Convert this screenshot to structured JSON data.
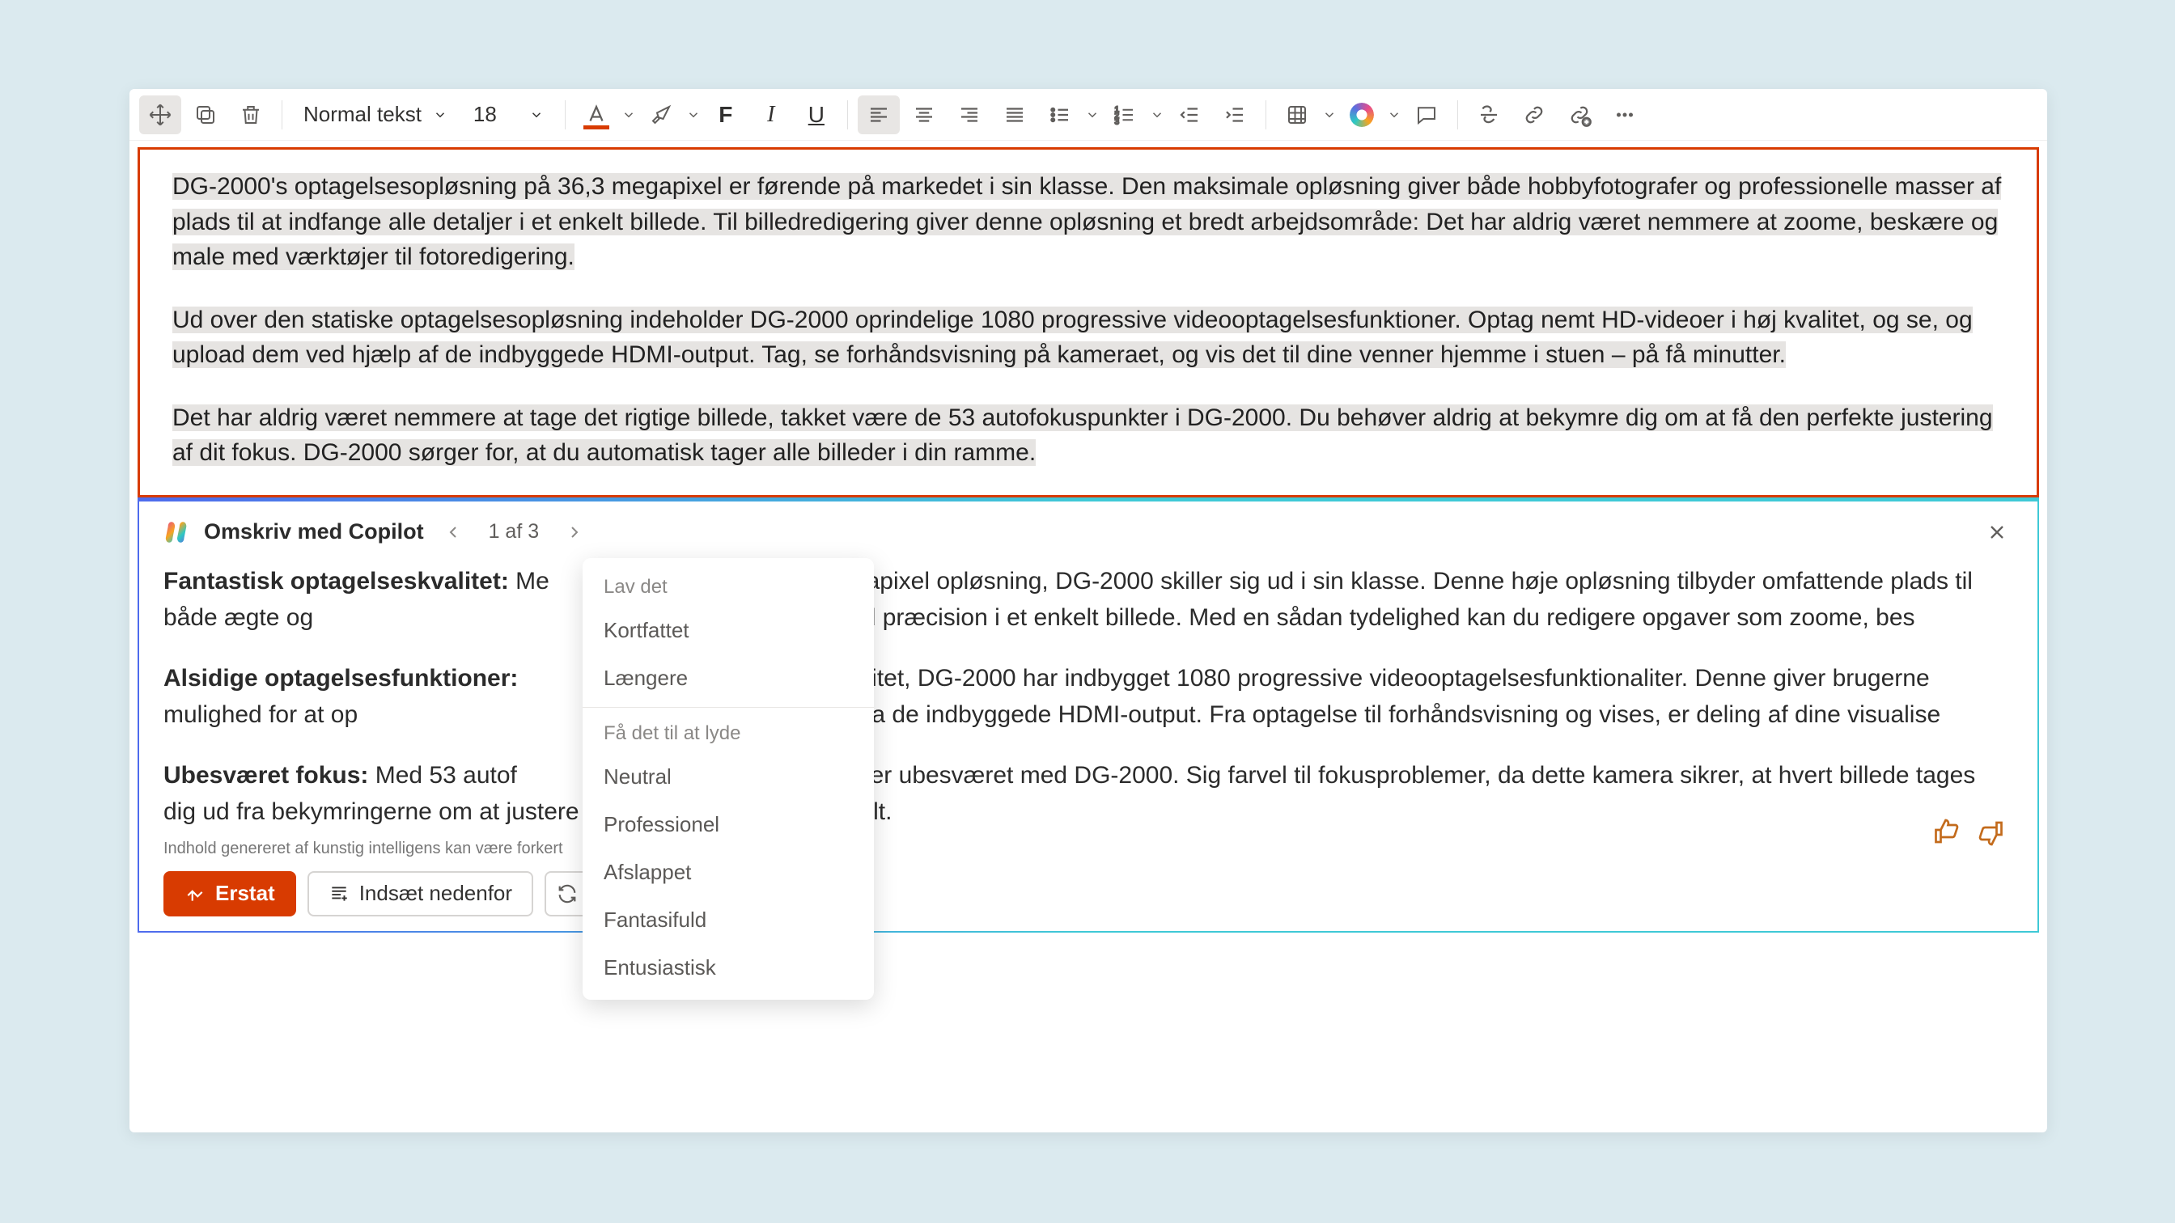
{
  "toolbar": {
    "style": "Normal tekst",
    "fontSize": "18"
  },
  "doc": {
    "p1": "DG-2000's optagelsesopløsning på 36,3 megapixel er førende på markedet i sin klasse. Den maksimale opløsning giver både hobbyfotografer og professionelle masser af plads til at indfange alle detaljer i et enkelt billede. Til billedredigering giver denne opløsning et bredt arbejdsområde: Det har aldrig været nemmere at zoome, beskære og male med værktøjer til fotoredigering.",
    "p2": "Ud over den statiske optagelsesopløsning indeholder DG-2000 oprindelige 1080 progressive videooptagelsesfunktioner. Optag nemt HD-videoer i høj kvalitet, og se, og upload dem ved hjælp af de indbyggede HDMI-output. Tag, se forhåndsvisning på kameraet, og vis det til dine venner hjemme i stuen – på få minutter.",
    "p3": "Det har aldrig været nemmere at tage det rigtige billede, takket være de 53 autofokuspunkter i DG-2000. Du behøver aldrig at bekymre dig om at få den perfekte justering af dit fokus. DG-2000 sørger for, at du automatisk tager alle billeder i din ramme."
  },
  "copilot": {
    "title": "Omskriv med Copilot",
    "counter": "1 af 3",
    "p1b": "Fantastisk optagelseskvalitet:",
    "p1": " Me                                             gapixel opløsning, DG-2000 skiller sig ud i sin klasse. Denne høje opløsning tilbyder omfattende plads til både ægte og                                            tag intrikate detaljer med præcision i et enkelt billede. Med en sådan tydelighed kan du redigere opgaver som zoome, bes",
    "p2b": "Alsidige optagelsesfunktioner:",
    "p2": "                                              kvalitet, DG-2000 har indbygget 1080 progressive videooptagelsesfunktionaliter. Denne giver brugerne mulighed for at op                                     kan du nemt dele dem via de indbyggede HDMI-output. Fra optagelse til forhåndsvisning og vises, er deling af dine visualise",
    "p3b": "Ubesværet fokus:",
    "p3": " Med 53 autof                                         øjeblik er ubesværet med DG-2000. Sig farvel til fokusproblemer, da dette kamera sikrer, at hvert billede tages                                               dig ud fra bekymringerne om at justere fokusindstillingerne manuelt.",
    "disclaimer": "Indhold genereret af kunstig intelligens kan være forkert",
    "replace": "Erstat",
    "insertBelow": "Indsæt nedenfor"
  },
  "menu": {
    "group1Label": "Lav det",
    "item1": "Kortfattet",
    "item2": "Længere",
    "group2Label": "Få det til at lyde",
    "item3": "Neutral",
    "item4": "Professionel",
    "item5": "Afslappet",
    "item6": "Fantasifuld",
    "item7": "Entusiastisk"
  }
}
